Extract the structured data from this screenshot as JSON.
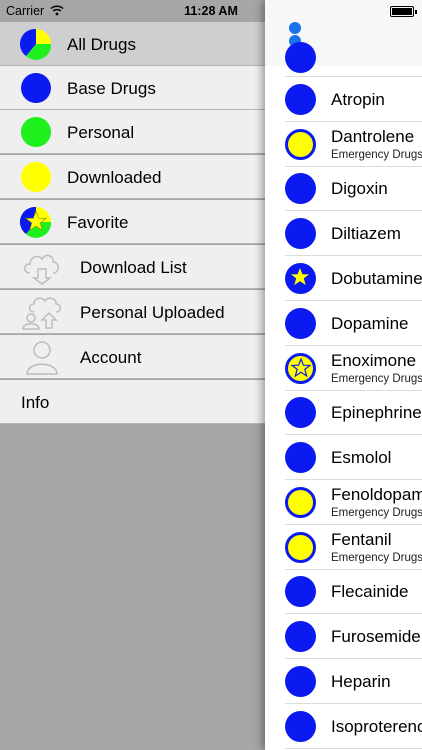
{
  "status_bar": {
    "carrier": "Carrier",
    "time": "11:28 AM"
  },
  "menu": {
    "items": [
      {
        "label": "All Drugs",
        "icon": "all-drugs-pie-icon"
      },
      {
        "label": "Base Drugs",
        "icon": "blue-dot-icon"
      },
      {
        "label": "Personal",
        "icon": "green-dot-icon"
      },
      {
        "label": "Downloaded",
        "icon": "yellow-dot-icon"
      },
      {
        "label": "Favorite",
        "icon": "favorite-pie-star-icon"
      },
      {
        "label": "Download List",
        "icon": "cloud-download-icon"
      },
      {
        "label": "Personal Uploaded",
        "icon": "cloud-upload-person-icon"
      },
      {
        "label": "Account",
        "icon": "person-icon"
      },
      {
        "label": "Info"
      }
    ]
  },
  "drugs": [
    {
      "name": "Atropin",
      "color": "blue"
    },
    {
      "name": "Dantrolene",
      "subtitle": "Emergency Drugs",
      "color": "yellow"
    },
    {
      "name": "Digoxin",
      "color": "blue"
    },
    {
      "name": "Diltiazem",
      "color": "blue"
    },
    {
      "name": "Dobutamine",
      "color": "blue",
      "favorite": true
    },
    {
      "name": "Dopamine",
      "color": "blue"
    },
    {
      "name": "Enoximone",
      "subtitle": "Emergency Drugs",
      "color": "yellow",
      "favorite": true
    },
    {
      "name": "Epinephrine",
      "color": "blue"
    },
    {
      "name": "Esmolol",
      "color": "blue"
    },
    {
      "name": "Fenoldopam",
      "subtitle": "Emergency Drugs",
      "color": "yellow"
    },
    {
      "name": "Fentanil",
      "subtitle": "Emergency Drugs",
      "color": "yellow"
    },
    {
      "name": "Flecainide",
      "color": "blue"
    },
    {
      "name": "Furosemide",
      "color": "blue"
    },
    {
      "name": "Heparin",
      "color": "blue"
    },
    {
      "name": "Isoproterenol",
      "color": "blue"
    }
  ],
  "colors": {
    "blue": "#0a1af0",
    "yellow": "#ffff00",
    "green": "#1ef01e",
    "star": "#ffff00"
  }
}
